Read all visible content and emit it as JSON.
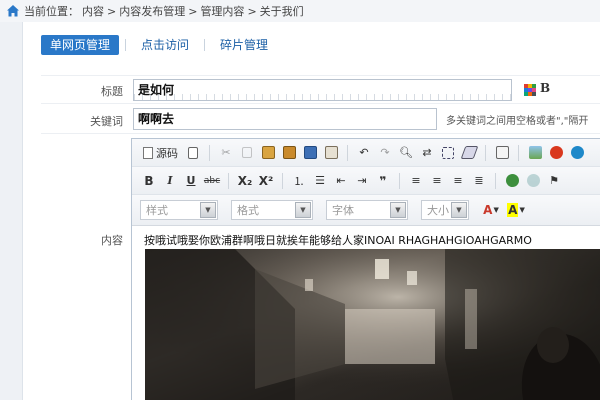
{
  "breadcrumb": {
    "prefix": "当前位置：",
    "items": [
      "内容",
      ">",
      "内容发布管理",
      ">",
      "管理内容",
      ">",
      "关于我们"
    ]
  },
  "tabs": [
    {
      "label": "单网页管理",
      "active": true
    },
    {
      "label": "点击访问",
      "active": false
    },
    {
      "label": "碎片管理",
      "active": false
    }
  ],
  "form": {
    "title_label": "标题",
    "title_value": "是如何",
    "bold_glyph": "B",
    "keywords_label": "关键词",
    "keywords_value": "啊啊去",
    "keywords_hint": "多关键词之间用空格或者\",\"隔开",
    "content_label": "内容"
  },
  "editor": {
    "source_label": "源码",
    "toolbar2": {
      "bold": "B",
      "italic": "I",
      "underline": "U",
      "strike": "abc",
      "subscript": "X₂",
      "superscript": "X²",
      "quote": "❞"
    },
    "toolbar3": {
      "style": "样式",
      "format": "格式",
      "font": "字体",
      "size": "大小",
      "font_color": "A",
      "bg_color": "A"
    },
    "content_text": "按哦试哦娶你欧浦群啊哦日就挨年能够给人家INOAI RHAGHAHGIOAHGARMO"
  },
  "colors": {
    "accent": "#2a78c8",
    "link": "#1b5fa6"
  }
}
